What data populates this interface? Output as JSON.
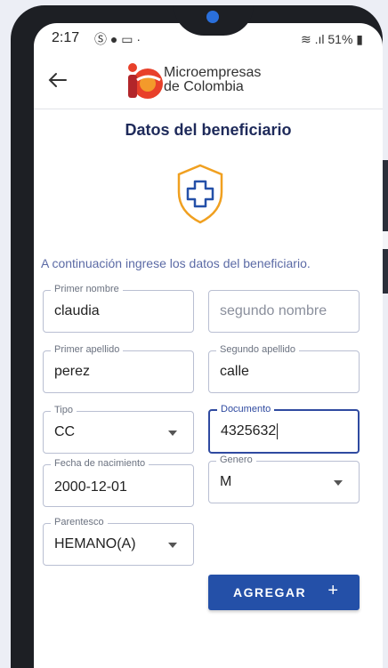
{
  "status": {
    "time": "2:17",
    "icons": "Ⓢ ● ▭ ·",
    "battery": "51%"
  },
  "brand": {
    "line1": "Microempresas",
    "line2": "de Colombia"
  },
  "title": "Datos del beneficiario",
  "instruction": "A continuación ingrese los datos del beneficiario.",
  "form": {
    "primer_nombre": {
      "label": "Primer nombre",
      "value": "claudia"
    },
    "segundo_nombre": {
      "placeholder": "segundo nombre"
    },
    "primer_apellido": {
      "label": "Primer apellido",
      "value": "perez"
    },
    "segundo_apellido": {
      "label": "Segundo apellido",
      "value": "calle"
    },
    "tipo": {
      "label": "Tipo",
      "value": "CC"
    },
    "documento": {
      "label": "Documento",
      "value": "4325632"
    },
    "fecha": {
      "label": "Fecha de nacimiento",
      "value": "2000-12-01"
    },
    "genero": {
      "label": "Genero",
      "value": "M"
    },
    "parentesco": {
      "label": "Parentesco",
      "value": "HEMANO(A)"
    }
  },
  "button": {
    "label": "AGREGAR",
    "icon": "+"
  },
  "colors": {
    "primary": "#2450a8",
    "title": "#1e2a5a",
    "accent_orange": "#f0a020",
    "logo_red": "#e8402a"
  }
}
